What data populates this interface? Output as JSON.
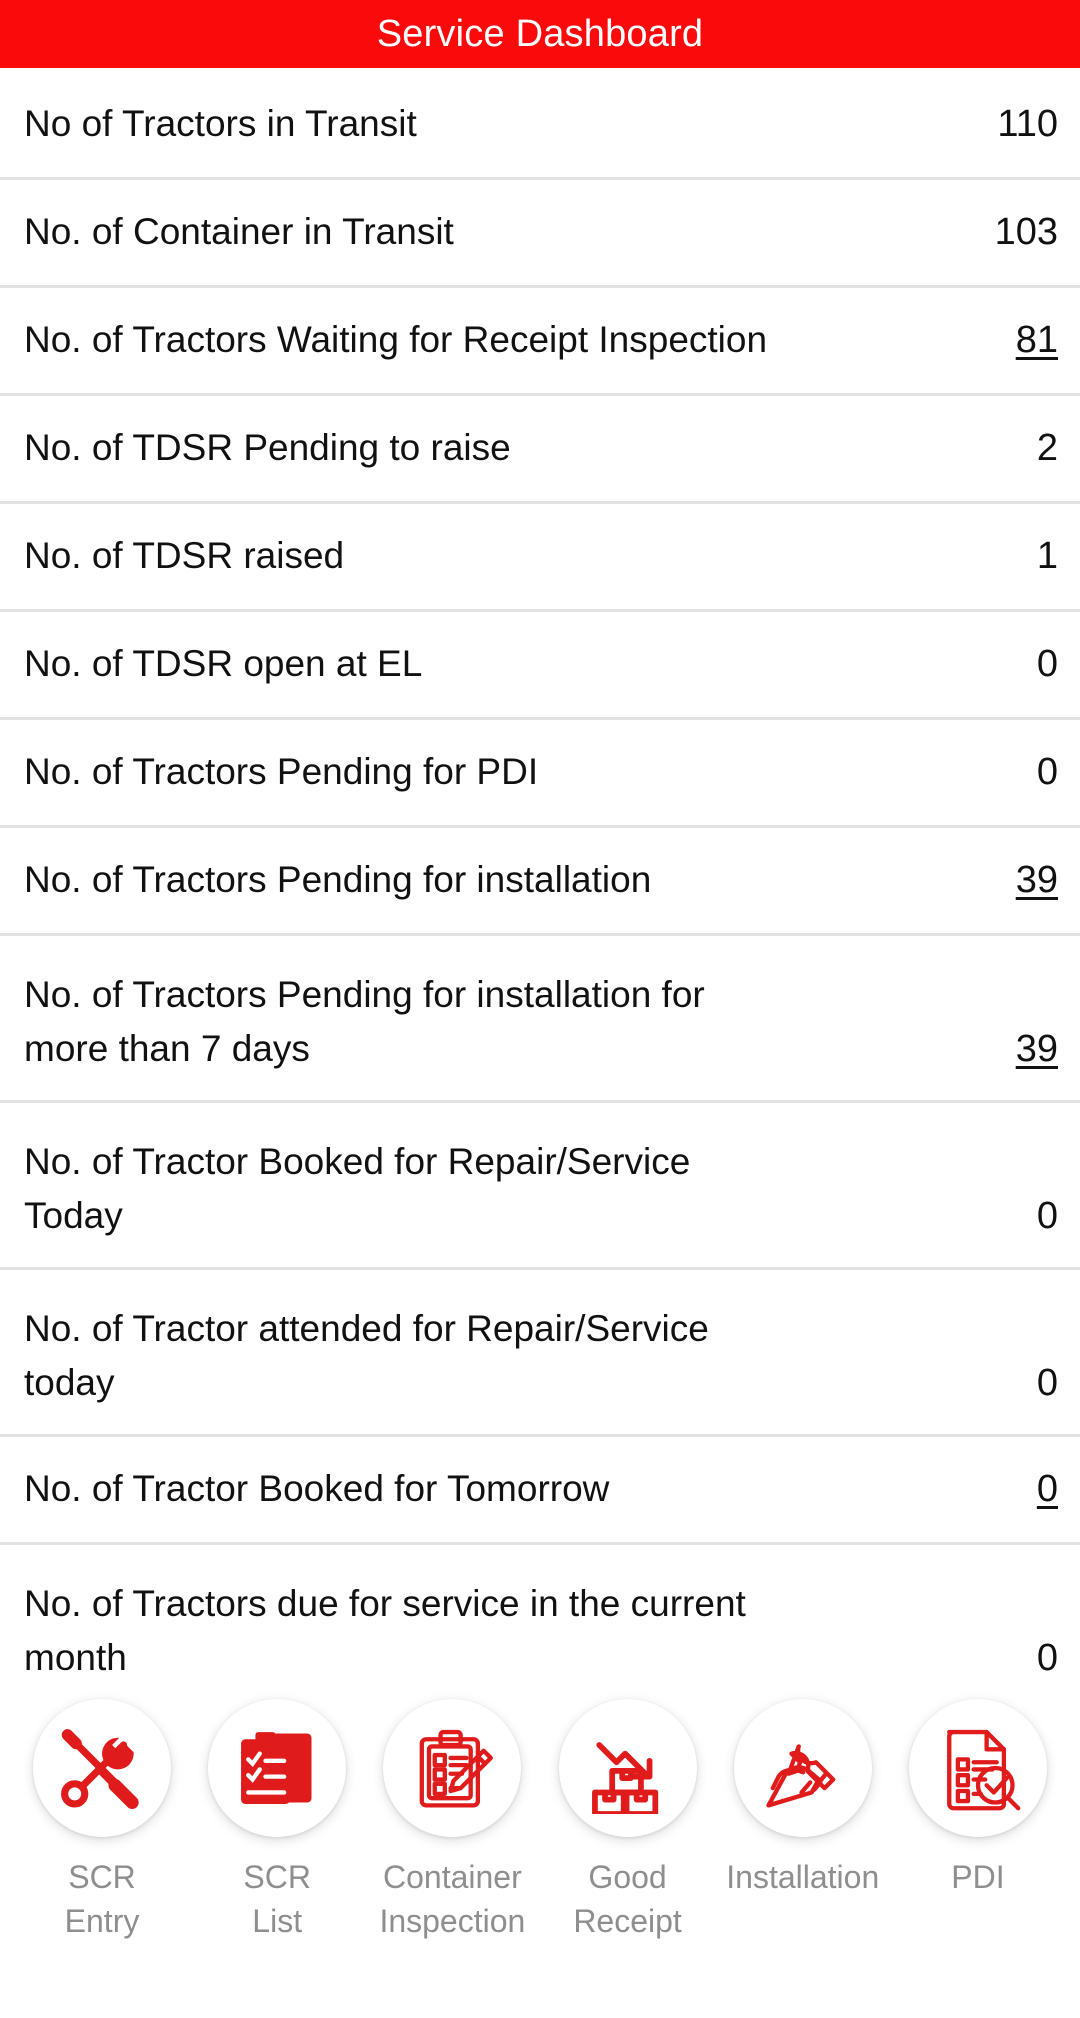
{
  "header": {
    "title": "Service Dashboard",
    "background_color": "#fa0a0a",
    "text_color": "#ffffff"
  },
  "theme": {
    "accent": "#e01b1b",
    "divider": "#e2e2e2",
    "label_color": "#111111",
    "nav_label_color": "#8e8e8e"
  },
  "dashboard": {
    "rows": [
      {
        "label": "No of Tractors in Transit",
        "value": "110",
        "link": false,
        "two_line": false
      },
      {
        "label": "No. of Container in Transit",
        "value": "103",
        "link": false,
        "two_line": false
      },
      {
        "label": "No. of Tractors Waiting for Receipt Inspection",
        "value": "81",
        "link": true,
        "two_line": false
      },
      {
        "label": "No. of TDSR Pending to raise",
        "value": "2",
        "link": false,
        "two_line": false
      },
      {
        "label": "No. of TDSR raised",
        "value": "1",
        "link": false,
        "two_line": false
      },
      {
        "label": "No. of TDSR open at EL",
        "value": "0",
        "link": false,
        "two_line": false
      },
      {
        "label": "No. of Tractors Pending for PDI",
        "value": "0",
        "link": false,
        "two_line": false
      },
      {
        "label": "No. of Tractors Pending for installation",
        "value": "39",
        "link": true,
        "two_line": false
      },
      {
        "label": "No. of Tractors Pending for installation for more than 7 days",
        "value": "39",
        "link": true,
        "two_line": true
      },
      {
        "label": "No. of Tractor Booked for Repair/Service Today",
        "value": "0",
        "link": false,
        "two_line": true
      },
      {
        "label": "No. of Tractor attended for Repair/Service today",
        "value": "0",
        "link": false,
        "two_line": true
      },
      {
        "label": "No. of Tractor Booked for Tomorrow",
        "value": "0",
        "link": true,
        "two_line": false
      },
      {
        "label": "No. of Tractors due for service in the current month",
        "value": "0",
        "link": false,
        "two_line": true
      }
    ]
  },
  "bottom_nav": {
    "items": [
      {
        "label": "SCR\nEntry",
        "icon": "wrench-screwdriver-icon"
      },
      {
        "label": "SCR\nList",
        "icon": "clipboard-checklist-icon"
      },
      {
        "label": "Container\nInspection",
        "icon": "clipboard-pencil-icon"
      },
      {
        "label": "Good\nReceipt",
        "icon": "boxes-down-arrow-icon"
      },
      {
        "label": "Installation",
        "icon": "hand-wrench-icon"
      },
      {
        "label": "PDI",
        "icon": "document-magnifier-check-icon"
      }
    ]
  }
}
